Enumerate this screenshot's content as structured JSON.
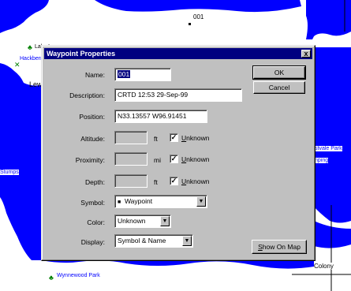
{
  "map": {
    "labels": {
      "waypoint_001": "001",
      "lake_lev": "Lake Lev",
      "hackberry": "Hackberry Pa",
      "lew": "Lew",
      "stumps": "Stumps",
      "eastvale_park": "stvale Park",
      "camping": "nping",
      "colony": "Colony",
      "wynnewood_park": "Wynnewood Park"
    },
    "water_color": "#0000ff"
  },
  "dialog": {
    "title": "Waypoint Properties",
    "close_glyph": "x",
    "name_label": "Name:",
    "name_value": "001",
    "description_label": "Description:",
    "description_value": "CRTD 12:53 29-Sep-99",
    "position_label": "Position:",
    "position_value": "N33.13557 W96.91451",
    "altitude_label": "Altitude:",
    "altitude_unit": "ft",
    "proximity_label": "Proximity:",
    "proximity_unit": "mi",
    "depth_label": "Depth:",
    "depth_unit": "ft",
    "unknown_label_pre": "U",
    "unknown_label_post": "nknown",
    "symbol_label": "Symbol:",
    "symbol_value": "Waypoint",
    "color_label": "Color:",
    "color_value": "Unknown",
    "display_label": "Display:",
    "display_value": "Symbol & Name",
    "ok_label": "OK",
    "cancel_label": "Cancel",
    "show_on_map_pre": "S",
    "show_on_map_post": "how On Map"
  }
}
